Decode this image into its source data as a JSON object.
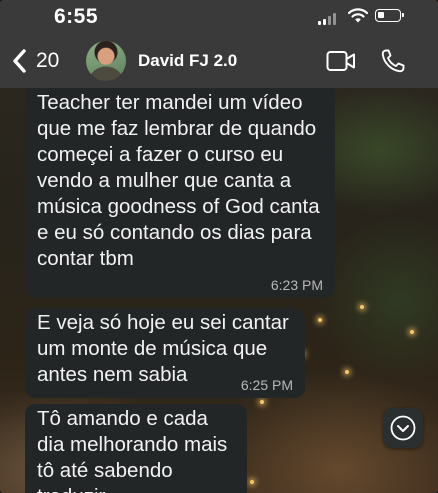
{
  "status_bar": {
    "time": "6:55"
  },
  "header": {
    "back_count": "20",
    "contact_name": "David FJ 2.0"
  },
  "messages": [
    {
      "text": "Teacher ter mandei um vídeo que me faz lembrar de quando começei a fazer o curso eu vendo a mulher que canta a música goodness of God canta e eu só contando os dias para contar tbm",
      "time": "6:23 PM"
    },
    {
      "text": "E veja só hoje eu sei cantar um monte de música que antes nem sabia",
      "time": "6:25 PM"
    },
    {
      "text": "Tô amando e cada dia melhorando mais tô até sabendo traduzir",
      "time": ""
    }
  ],
  "colors": {
    "bar_bg": "#3a3a3a",
    "bubble_bg": "#232627",
    "text": "#f2f2f2",
    "timestamp": "#b8b8b8"
  },
  "icons": [
    "back-chevron-icon",
    "video-call-icon",
    "phone-icon",
    "chevron-down-icon",
    "signal-icon",
    "wifi-icon",
    "battery-icon"
  ]
}
